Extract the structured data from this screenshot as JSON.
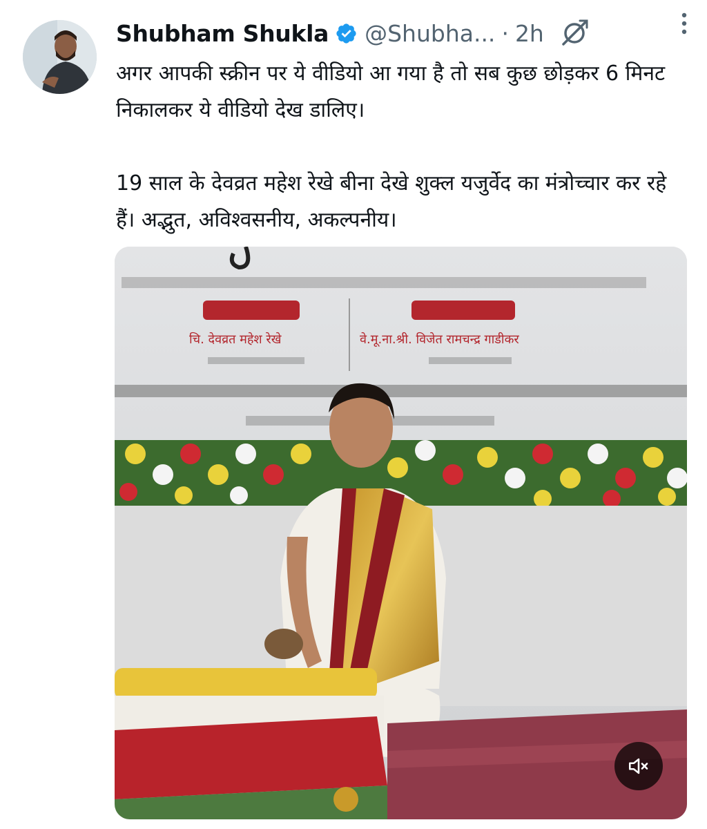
{
  "tweet": {
    "author_name": "Shubham Shukla",
    "handle": "@Shubha...",
    "separator": "·",
    "time": "2h",
    "text": "अगर आपकी स्क्रीन पर ये वीडियो आ गया है तो सब कुछ छोड़कर 6 मिनट निकालकर ये वीडियो देख डालिए।\n\n19 साल के देवव्रत महेश रेखे बीना देखे शुक्ल यजुर्वेद का मंत्रोच्चार कर रहे हैं। अद्भुत, अविश्वसनीय, अकल्पनीय।"
  },
  "icons": {
    "verified": "verified-badge-icon",
    "grok": "grok-icon",
    "more": "more-options-icon",
    "mute": "volume-muted-icon"
  },
  "colors": {
    "verified_blue": "#1d9bf0",
    "secondary_text": "#536471",
    "banner_red": "#b3262d"
  },
  "media": {
    "banner_name_left": "चि. देवव्रत महेश रेखे",
    "banner_name_right": "वे.मू.ना.श्री. विजेत रामचन्द्र गाडीकर"
  }
}
